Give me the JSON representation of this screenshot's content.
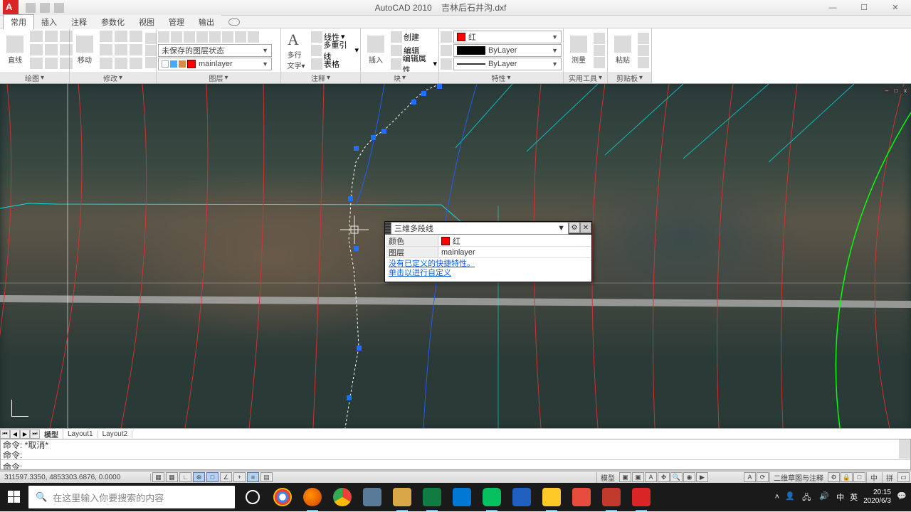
{
  "title": {
    "app": "AutoCAD 2010",
    "file": "吉林后石井沟.dxf"
  },
  "menu": {
    "tabs": [
      "常用",
      "插入",
      "注释",
      "参数化",
      "视图",
      "管理",
      "输出"
    ]
  },
  "ribbon": {
    "draw": {
      "line": "直线",
      "title": "绘图"
    },
    "modify": {
      "move": "移动",
      "title": "修改"
    },
    "layer": {
      "unsaved": "未保存的图层状态",
      "layername": "mainlayer",
      "title": "图层"
    },
    "annot": {
      "text": "多行\n文字",
      "linear": "线性",
      "mleader": "多重引线",
      "table": "表格",
      "title": "注释"
    },
    "block": {
      "insert": "插入",
      "create": "创建",
      "edit": "编辑",
      "attr": "编辑属性",
      "title": "块"
    },
    "props": {
      "color": "红",
      "bylayer1": "ByLayer",
      "bylayer2": "ByLayer",
      "title": "特性"
    },
    "util": {
      "measure": "测量",
      "title": "实用工具"
    },
    "clip": {
      "paste": "粘贴",
      "title": "剪贴板"
    }
  },
  "quickprops": {
    "type": "三维多段线",
    "rows": [
      {
        "label": "颜色",
        "value": "红",
        "swatch": "red"
      },
      {
        "label": "图层",
        "value": "mainlayer"
      }
    ],
    "links": [
      "没有已定义的快捷特性。",
      "单击以进行自定义"
    ]
  },
  "layout": {
    "tabs": [
      "模型",
      "Layout1",
      "Layout2"
    ]
  },
  "cmd": {
    "lines": [
      "命令: *取消*",
      "命令:"
    ],
    "prompt": "命令:"
  },
  "status": {
    "coords": "311597.3350, 4853303.6876, 0.0000",
    "ms": "模型",
    "annot": "二维草图与注释",
    "ime": "中",
    "lang": "拼"
  },
  "taskbar": {
    "search": "在这里输入你要搜索的内容",
    "time": "20:15",
    "date": "2020/6/3",
    "lang1": "中",
    "lang2": "英"
  },
  "chart_data": null
}
